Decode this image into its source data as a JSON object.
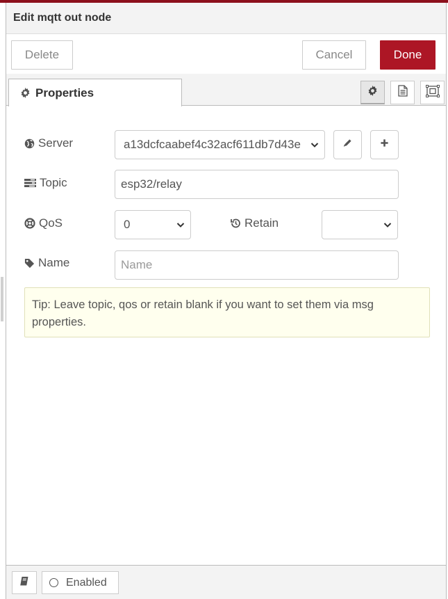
{
  "header": {
    "title": "Edit mqtt out node"
  },
  "toolbar": {
    "delete_label": "Delete",
    "cancel_label": "Cancel",
    "done_label": "Done"
  },
  "tabs": [
    {
      "label": "Properties",
      "icon": "gear-icon"
    }
  ],
  "tab_icons": [
    "gear-icon",
    "document-icon",
    "frame-icon"
  ],
  "form": {
    "server": {
      "label": "Server",
      "icon": "globe-icon",
      "value": "a13dcfcaabef4c32acf611db7d43e"
    },
    "topic": {
      "label": "Topic",
      "icon": "tasks-icon",
      "value": "esp32/relay"
    },
    "qos": {
      "label": "QoS",
      "icon": "life-ring-icon",
      "value": "0"
    },
    "retain": {
      "label": "Retain",
      "icon": "history-icon",
      "value": ""
    },
    "name": {
      "label": "Name",
      "icon": "tag-icon",
      "value": "",
      "placeholder": "Name"
    }
  },
  "tip": {
    "text": "Tip: Leave topic, qos or retain blank if you want to set them via msg properties."
  },
  "footer": {
    "enabled_label": "Enabled",
    "book_icon": "book-icon"
  },
  "colors": {
    "accent": "#ad1625",
    "tip_bg": "#ffffee",
    "header_bg": "#f3f3f3"
  }
}
